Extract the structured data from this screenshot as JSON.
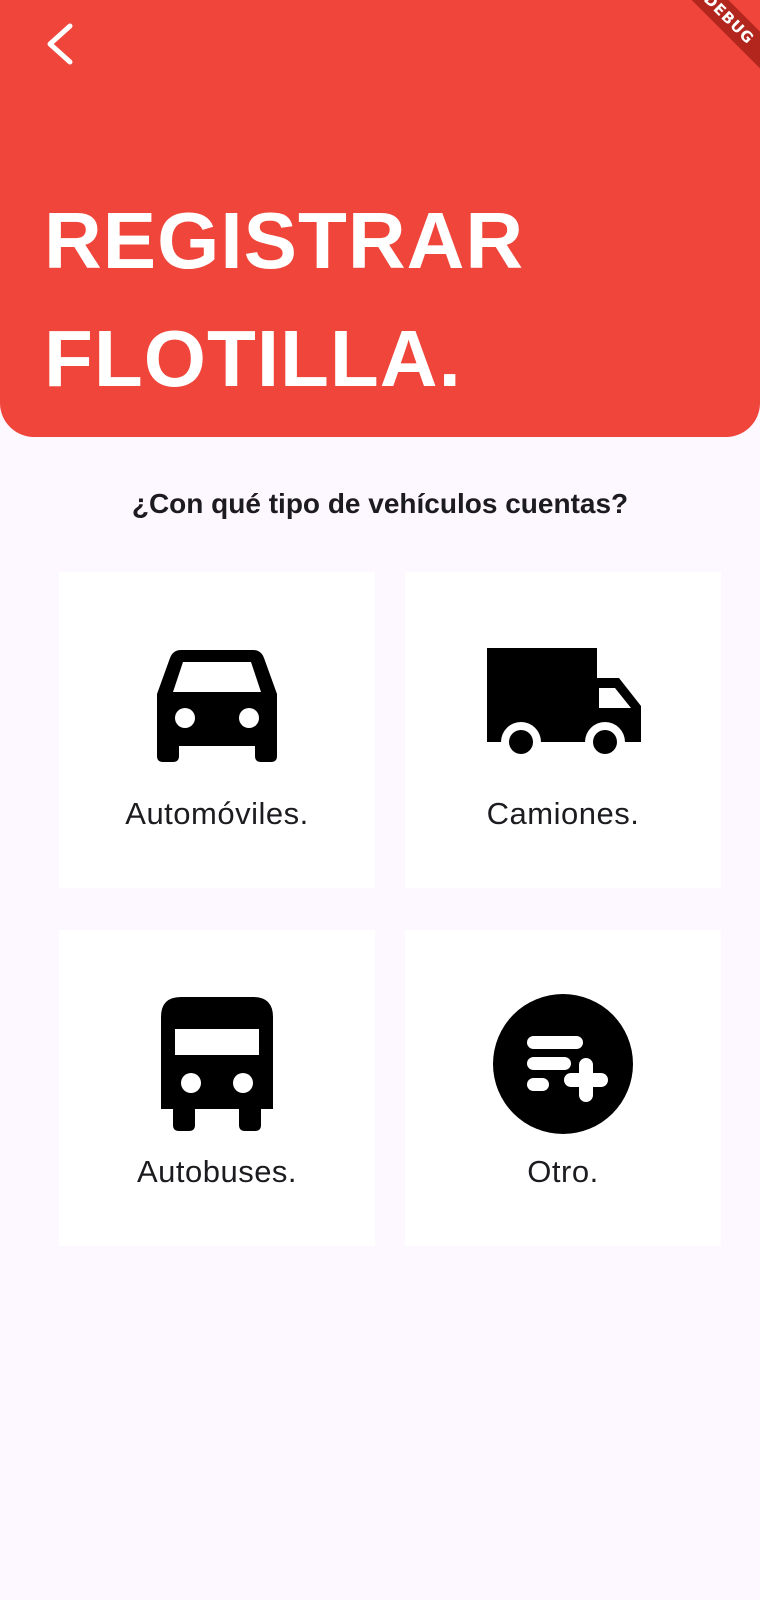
{
  "header": {
    "title_line1": "REGISTRAR",
    "title_line2": "FLOTILLA.",
    "back_icon": "chevron-left-icon",
    "background_color": "#f0453a",
    "debug_banner": "DEBUG"
  },
  "question": "¿Con qué tipo de vehículos cuentas?",
  "options": [
    {
      "label": "Automóviles.",
      "icon": "car-icon"
    },
    {
      "label": "Camiones.",
      "icon": "truck-icon"
    },
    {
      "label": "Autobuses.",
      "icon": "bus-icon"
    },
    {
      "label": "Otro.",
      "icon": "playlist-add-circle-icon"
    }
  ]
}
